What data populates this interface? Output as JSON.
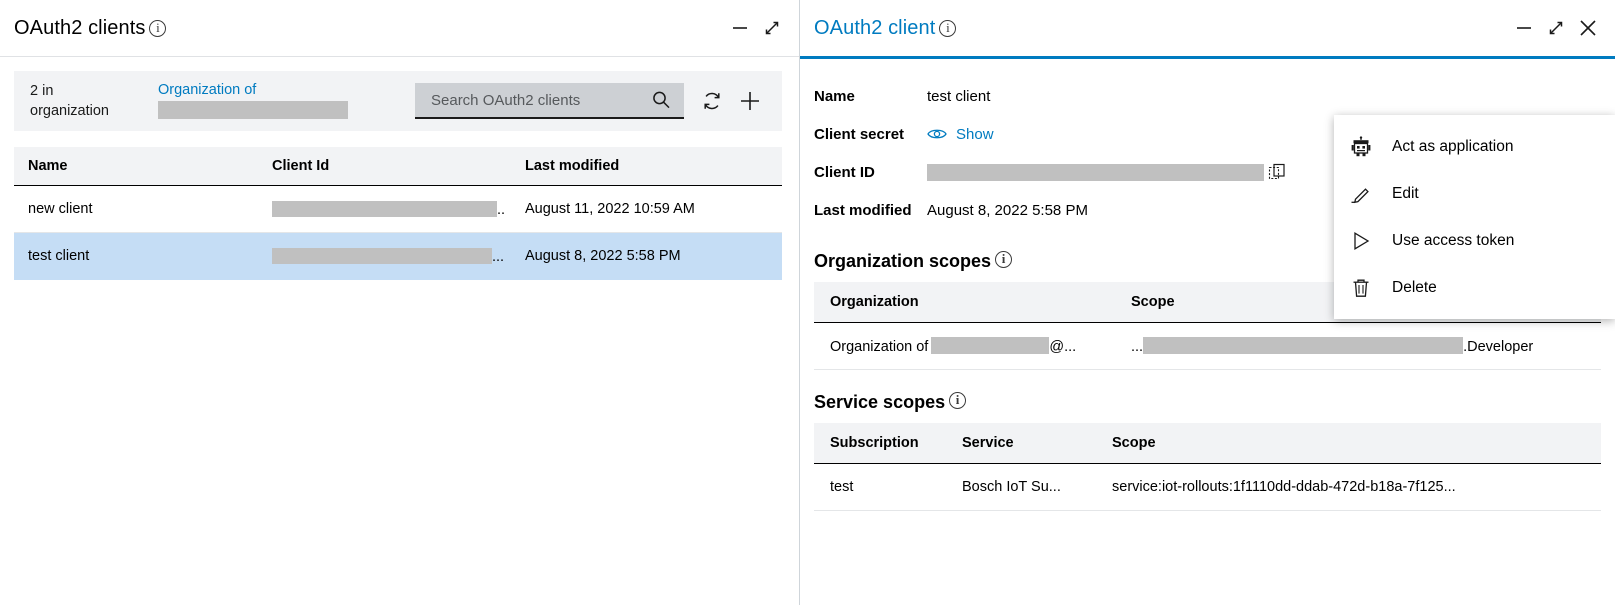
{
  "left_panel": {
    "title": "OAuth2 clients",
    "info_icon": "info-icon",
    "window_controls": {
      "minimize": "minimize-icon",
      "expand": "expand-icon"
    },
    "toolbar": {
      "count_line1": "2 in",
      "count_line2": "organization",
      "org_link": "Organization of",
      "org_redacted": "",
      "search_placeholder": "Search OAuth2 clients",
      "search_value": "",
      "search_icon": "search-icon",
      "refresh_icon": "refresh-icon",
      "add_icon": "plus-icon"
    },
    "table": {
      "columns": [
        "Name",
        "Client Id",
        "Last modified"
      ],
      "rows": [
        {
          "name": "new client",
          "client_id": "",
          "client_id_suffix": "..",
          "last_modified": "August 11, 2022 10:59 AM",
          "selected": false
        },
        {
          "name": "test client",
          "client_id": "",
          "client_id_suffix": "...",
          "last_modified": "August 8, 2022 5:58 PM",
          "selected": true
        }
      ]
    }
  },
  "right_panel": {
    "title": "OAuth2 client",
    "info_icon": "info-icon",
    "window_controls": {
      "minimize": "minimize-icon",
      "expand": "expand-icon",
      "close": "close-icon"
    },
    "tools_icon": "tools-icon",
    "fields": {
      "name_label": "Name",
      "name_value": "test client",
      "client_secret_label": "Client secret",
      "client_secret_action": "Show",
      "client_secret_icon": "eye-icon",
      "client_id_label": "Client ID",
      "client_id_value": "",
      "client_id_copy_icon": "copy-icon",
      "last_modified_label": "Last modified",
      "last_modified_value": "August 8, 2022 5:58 PM"
    },
    "organization_scopes": {
      "title": "Organization scopes",
      "info_icon": "info-icon",
      "columns": [
        "Organization",
        "Scope"
      ],
      "rows": [
        {
          "organization_prefix": "Organization of",
          "organization_redacted": "",
          "organization_suffix": "@...",
          "scope_prefix": "...",
          "scope_redacted": "",
          "scope_suffix": ".Developer"
        }
      ]
    },
    "service_scopes": {
      "title": "Service scopes",
      "info_icon": "info-icon",
      "columns": [
        "Subscription",
        "Service",
        "Scope"
      ],
      "rows": [
        {
          "subscription": "test",
          "service": "Bosch IoT Su...",
          "scope": "service:iot-rollouts:1f1110dd-ddab-472d-b18a-7f125..."
        }
      ]
    },
    "context_menu": {
      "items": [
        {
          "label": "Act as application",
          "icon": "robot-icon"
        },
        {
          "label": "Edit",
          "icon": "pencil-icon"
        },
        {
          "label": "Use access token",
          "icon": "play-icon"
        },
        {
          "label": "Delete",
          "icon": "trash-icon"
        }
      ]
    }
  },
  "colors": {
    "accent": "#007bc0",
    "selected_row": "#c5ddf5",
    "header_bg": "#f2f3f5",
    "redaction": "#c0c0c0"
  }
}
